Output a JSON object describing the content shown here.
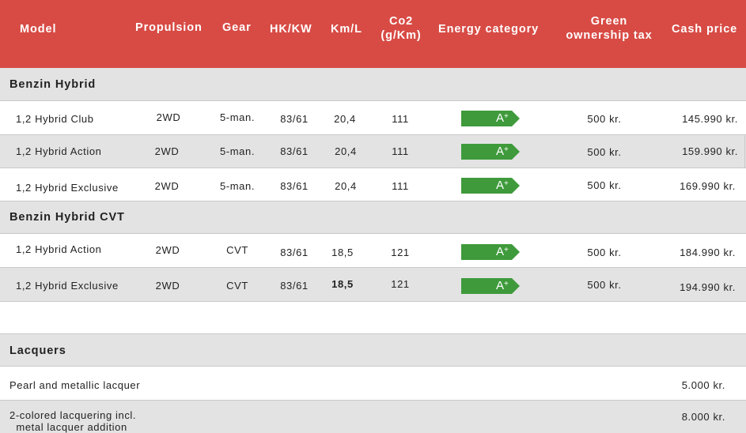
{
  "header": {
    "model": "Model",
    "propulsion": "Propulsion",
    "gear": "Gear",
    "hk_kw": "HK/KW",
    "km_l": "Km/L",
    "co2": "Co2\n(g/Km)",
    "energy_category": "Energy category",
    "green_tax": "Green\nownership tax",
    "cash_price": "Cash price"
  },
  "groups": [
    {
      "title": "Benzin Hybrid",
      "rows": [
        {
          "model": "1,2 Hybrid Club",
          "propulsion": "2WD",
          "gear": "5-man.",
          "hk_kw": "83/61",
          "km_l": "20,4",
          "co2": "111",
          "energy": "A+",
          "tax": "500 kr.",
          "price": "145.990 kr."
        },
        {
          "model": "1,2 Hybrid Action",
          "propulsion": "2WD",
          "gear": "5-man.",
          "hk_kw": "83/61",
          "km_l": "20,4",
          "co2": "111",
          "energy": "A+",
          "tax": "500 kr.",
          "price": "159.990 kr."
        },
        {
          "model": "1,2 Hybrid Exclusive",
          "propulsion": "2WD",
          "gear": "5-man.",
          "hk_kw": "83/61",
          "km_l": "20,4",
          "co2": "111",
          "energy": "A+",
          "tax": "500 kr.",
          "price": "169.990 kr."
        }
      ]
    },
    {
      "title": "Benzin Hybrid CVT",
      "rows": [
        {
          "model": "1,2 Hybrid Action",
          "propulsion": "2WD",
          "gear": "CVT",
          "hk_kw": "83/61",
          "km_l": "18,5",
          "co2": "121",
          "energy": "A+",
          "tax": "500 kr.",
          "price": "184.990 kr."
        },
        {
          "model": "1,2 Hybrid Exclusive",
          "propulsion": "2WD",
          "gear": "CVT",
          "hk_kw": "83/61",
          "km_l": "18,5",
          "co2": "121",
          "energy": "A+",
          "tax": "500 kr.",
          "price": "194.990 kr."
        }
      ]
    }
  ],
  "lacquers": {
    "title": "Lacquers",
    "rows": [
      {
        "label": "Pearl and metallic lacquer",
        "price": "5.000 kr."
      },
      {
        "label": "2-colored lacquering incl.\n  metal lacquer addition",
        "price": "8.000 kr."
      }
    ]
  },
  "colors": {
    "header_bg": "#d84b45",
    "energy_green": "#3f9a3c",
    "band_gray": "#e3e3e3"
  }
}
